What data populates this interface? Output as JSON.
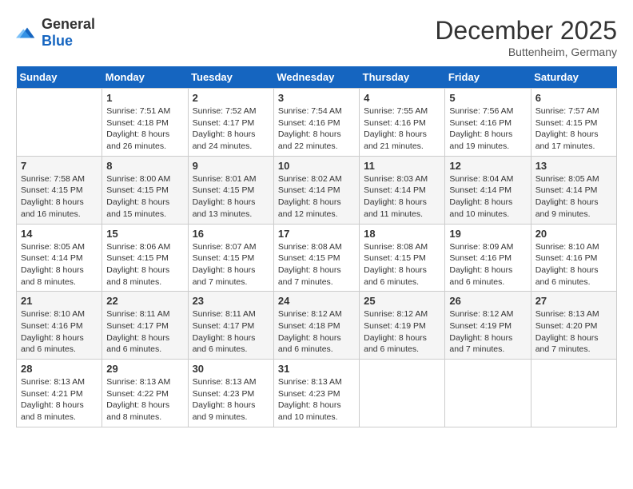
{
  "logo": {
    "general": "General",
    "blue": "Blue"
  },
  "title": "December 2025",
  "subtitle": "Buttenheim, Germany",
  "days_of_week": [
    "Sunday",
    "Monday",
    "Tuesday",
    "Wednesday",
    "Thursday",
    "Friday",
    "Saturday"
  ],
  "weeks": [
    [
      {
        "num": "",
        "sunrise": "",
        "sunset": "",
        "daylight": "",
        "empty": true
      },
      {
        "num": "1",
        "sunrise": "Sunrise: 7:51 AM",
        "sunset": "Sunset: 4:18 PM",
        "daylight": "Daylight: 8 hours and 26 minutes."
      },
      {
        "num": "2",
        "sunrise": "Sunrise: 7:52 AM",
        "sunset": "Sunset: 4:17 PM",
        "daylight": "Daylight: 8 hours and 24 minutes."
      },
      {
        "num": "3",
        "sunrise": "Sunrise: 7:54 AM",
        "sunset": "Sunset: 4:16 PM",
        "daylight": "Daylight: 8 hours and 22 minutes."
      },
      {
        "num": "4",
        "sunrise": "Sunrise: 7:55 AM",
        "sunset": "Sunset: 4:16 PM",
        "daylight": "Daylight: 8 hours and 21 minutes."
      },
      {
        "num": "5",
        "sunrise": "Sunrise: 7:56 AM",
        "sunset": "Sunset: 4:16 PM",
        "daylight": "Daylight: 8 hours and 19 minutes."
      },
      {
        "num": "6",
        "sunrise": "Sunrise: 7:57 AM",
        "sunset": "Sunset: 4:15 PM",
        "daylight": "Daylight: 8 hours and 17 minutes."
      }
    ],
    [
      {
        "num": "7",
        "sunrise": "Sunrise: 7:58 AM",
        "sunset": "Sunset: 4:15 PM",
        "daylight": "Daylight: 8 hours and 16 minutes."
      },
      {
        "num": "8",
        "sunrise": "Sunrise: 8:00 AM",
        "sunset": "Sunset: 4:15 PM",
        "daylight": "Daylight: 8 hours and 15 minutes."
      },
      {
        "num": "9",
        "sunrise": "Sunrise: 8:01 AM",
        "sunset": "Sunset: 4:15 PM",
        "daylight": "Daylight: 8 hours and 13 minutes."
      },
      {
        "num": "10",
        "sunrise": "Sunrise: 8:02 AM",
        "sunset": "Sunset: 4:14 PM",
        "daylight": "Daylight: 8 hours and 12 minutes."
      },
      {
        "num": "11",
        "sunrise": "Sunrise: 8:03 AM",
        "sunset": "Sunset: 4:14 PM",
        "daylight": "Daylight: 8 hours and 11 minutes."
      },
      {
        "num": "12",
        "sunrise": "Sunrise: 8:04 AM",
        "sunset": "Sunset: 4:14 PM",
        "daylight": "Daylight: 8 hours and 10 minutes."
      },
      {
        "num": "13",
        "sunrise": "Sunrise: 8:05 AM",
        "sunset": "Sunset: 4:14 PM",
        "daylight": "Daylight: 8 hours and 9 minutes."
      }
    ],
    [
      {
        "num": "14",
        "sunrise": "Sunrise: 8:05 AM",
        "sunset": "Sunset: 4:14 PM",
        "daylight": "Daylight: 8 hours and 8 minutes."
      },
      {
        "num": "15",
        "sunrise": "Sunrise: 8:06 AM",
        "sunset": "Sunset: 4:15 PM",
        "daylight": "Daylight: 8 hours and 8 minutes."
      },
      {
        "num": "16",
        "sunrise": "Sunrise: 8:07 AM",
        "sunset": "Sunset: 4:15 PM",
        "daylight": "Daylight: 8 hours and 7 minutes."
      },
      {
        "num": "17",
        "sunrise": "Sunrise: 8:08 AM",
        "sunset": "Sunset: 4:15 PM",
        "daylight": "Daylight: 8 hours and 7 minutes."
      },
      {
        "num": "18",
        "sunrise": "Sunrise: 8:08 AM",
        "sunset": "Sunset: 4:15 PM",
        "daylight": "Daylight: 8 hours and 6 minutes."
      },
      {
        "num": "19",
        "sunrise": "Sunrise: 8:09 AM",
        "sunset": "Sunset: 4:16 PM",
        "daylight": "Daylight: 8 hours and 6 minutes."
      },
      {
        "num": "20",
        "sunrise": "Sunrise: 8:10 AM",
        "sunset": "Sunset: 4:16 PM",
        "daylight": "Daylight: 8 hours and 6 minutes."
      }
    ],
    [
      {
        "num": "21",
        "sunrise": "Sunrise: 8:10 AM",
        "sunset": "Sunset: 4:16 PM",
        "daylight": "Daylight: 8 hours and 6 minutes."
      },
      {
        "num": "22",
        "sunrise": "Sunrise: 8:11 AM",
        "sunset": "Sunset: 4:17 PM",
        "daylight": "Daylight: 8 hours and 6 minutes."
      },
      {
        "num": "23",
        "sunrise": "Sunrise: 8:11 AM",
        "sunset": "Sunset: 4:17 PM",
        "daylight": "Daylight: 8 hours and 6 minutes."
      },
      {
        "num": "24",
        "sunrise": "Sunrise: 8:12 AM",
        "sunset": "Sunset: 4:18 PM",
        "daylight": "Daylight: 8 hours and 6 minutes."
      },
      {
        "num": "25",
        "sunrise": "Sunrise: 8:12 AM",
        "sunset": "Sunset: 4:19 PM",
        "daylight": "Daylight: 8 hours and 6 minutes."
      },
      {
        "num": "26",
        "sunrise": "Sunrise: 8:12 AM",
        "sunset": "Sunset: 4:19 PM",
        "daylight": "Daylight: 8 hours and 7 minutes."
      },
      {
        "num": "27",
        "sunrise": "Sunrise: 8:13 AM",
        "sunset": "Sunset: 4:20 PM",
        "daylight": "Daylight: 8 hours and 7 minutes."
      }
    ],
    [
      {
        "num": "28",
        "sunrise": "Sunrise: 8:13 AM",
        "sunset": "Sunset: 4:21 PM",
        "daylight": "Daylight: 8 hours and 8 minutes."
      },
      {
        "num": "29",
        "sunrise": "Sunrise: 8:13 AM",
        "sunset": "Sunset: 4:22 PM",
        "daylight": "Daylight: 8 hours and 8 minutes."
      },
      {
        "num": "30",
        "sunrise": "Sunrise: 8:13 AM",
        "sunset": "Sunset: 4:23 PM",
        "daylight": "Daylight: 8 hours and 9 minutes."
      },
      {
        "num": "31",
        "sunrise": "Sunrise: 8:13 AM",
        "sunset": "Sunset: 4:23 PM",
        "daylight": "Daylight: 8 hours and 10 minutes."
      },
      {
        "num": "",
        "sunrise": "",
        "sunset": "",
        "daylight": "",
        "empty": true
      },
      {
        "num": "",
        "sunrise": "",
        "sunset": "",
        "daylight": "",
        "empty": true
      },
      {
        "num": "",
        "sunrise": "",
        "sunset": "",
        "daylight": "",
        "empty": true
      }
    ]
  ]
}
